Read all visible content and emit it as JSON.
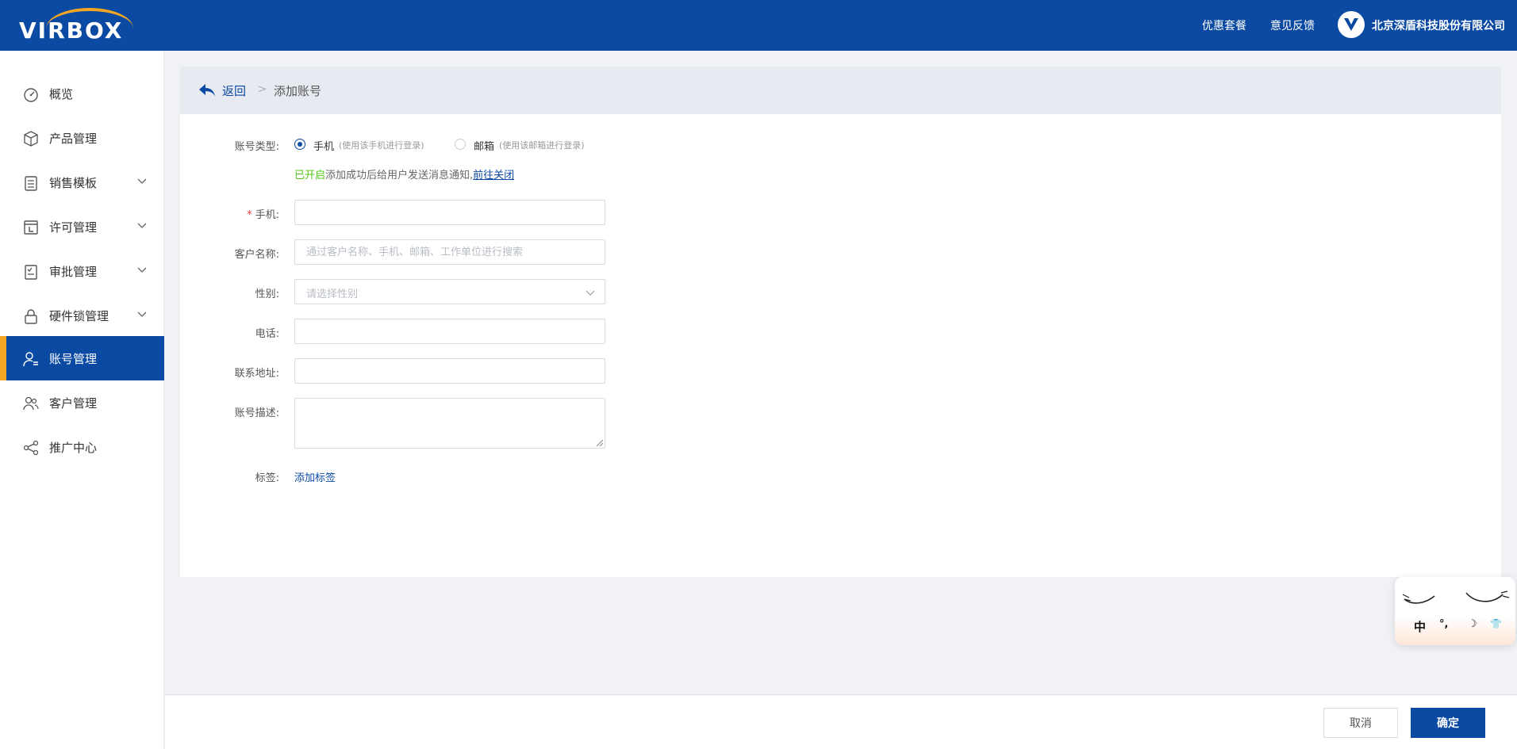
{
  "header": {
    "logo_text": "VIRBOX",
    "links": [
      "优惠套餐",
      "意见反馈"
    ],
    "company": "北京深盾科技股份有限公司"
  },
  "sidebar": {
    "items": [
      {
        "label": "概览",
        "icon": "dashboard-icon",
        "has_children": false
      },
      {
        "label": "产品管理",
        "icon": "cube-icon",
        "has_children": false
      },
      {
        "label": "销售模板",
        "icon": "template-icon",
        "has_children": true
      },
      {
        "label": "许可管理",
        "icon": "license-icon",
        "has_children": true
      },
      {
        "label": "审批管理",
        "icon": "approval-icon",
        "has_children": true
      },
      {
        "label": "硬件锁管理",
        "icon": "lock-icon",
        "has_children": true
      },
      {
        "label": "账号管理",
        "icon": "user-manage-icon",
        "has_children": false,
        "active": true
      },
      {
        "label": "客户管理",
        "icon": "customers-icon",
        "has_children": false
      },
      {
        "label": "推广中心",
        "icon": "share-icon",
        "has_children": false
      }
    ]
  },
  "breadcrumb": {
    "back": "返回",
    "separator": ">",
    "current": "添加账号"
  },
  "form": {
    "account_type": {
      "label": "账号类型:",
      "options": [
        {
          "label": "手机",
          "hint": "(使用该手机进行登录)",
          "selected": true
        },
        {
          "label": "邮箱",
          "hint": "(使用该邮箱进行登录)",
          "selected": false
        }
      ]
    },
    "notice": {
      "status": "已开启",
      "text": "添加成功后给用户发送消息通知,",
      "link": "前往关闭"
    },
    "phone": {
      "required_mark": "*",
      "label": "手机:",
      "value": "",
      "placeholder": ""
    },
    "customer_name": {
      "label": "客户名称:",
      "value": "",
      "placeholder": "通过客户名称、手机、邮箱、工作单位进行搜索"
    },
    "gender": {
      "label": "性别:",
      "placeholder": "请选择性别"
    },
    "telephone": {
      "label": "电话:",
      "value": "",
      "placeholder": ""
    },
    "address": {
      "label": "联系地址:",
      "value": "",
      "placeholder": ""
    },
    "description": {
      "label": "账号描述:",
      "value": ""
    },
    "tags": {
      "label": "标签:",
      "add_link": "添加标签"
    }
  },
  "footer": {
    "cancel": "取消",
    "confirm": "确定"
  },
  "ime": {
    "glyphs": [
      "中",
      "°,",
      "☽",
      "👕"
    ]
  },
  "colors": {
    "brand": "#0b4aa2",
    "accent": "#f5a623",
    "success": "#52c41a",
    "required": "#e53935"
  }
}
